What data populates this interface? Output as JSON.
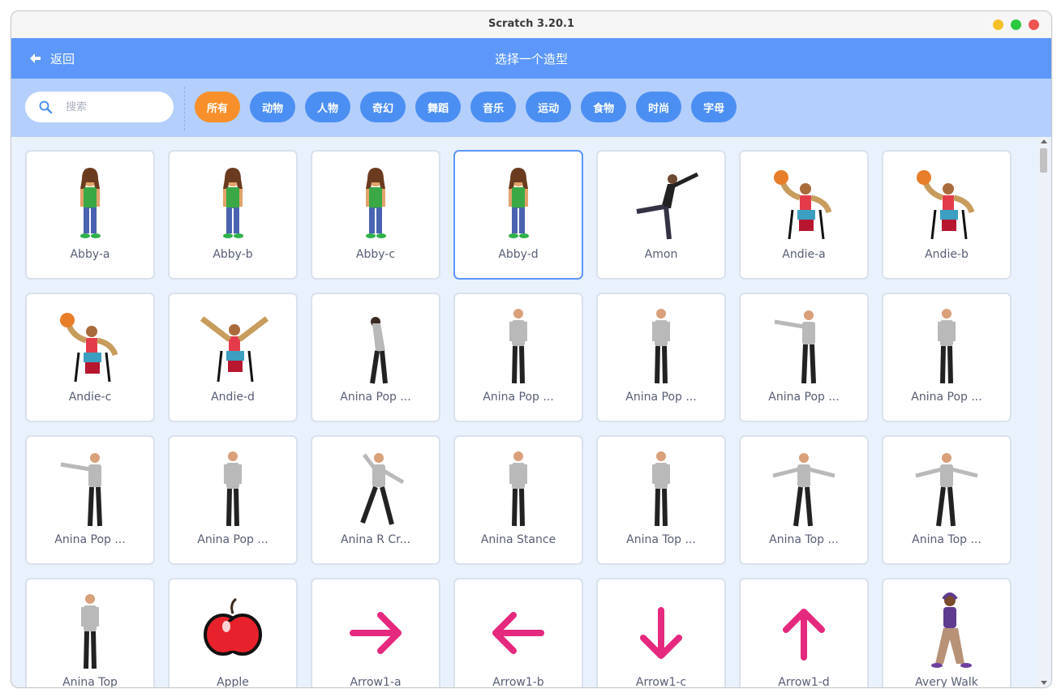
{
  "window": {
    "title": "Scratch 3.20.1"
  },
  "header": {
    "back_label": "返回",
    "title": "选择一个造型"
  },
  "search": {
    "placeholder": "搜索",
    "value": ""
  },
  "tags": [
    "所有",
    "动物",
    "人物",
    "奇幻",
    "舞蹈",
    "音乐",
    "运动",
    "食物",
    "时尚",
    "字母"
  ],
  "active_tag": "所有",
  "colors": {
    "header": "#5c97f9",
    "filter_bar": "#b4cffb",
    "tag": "#4c8ff2",
    "tag_active": "#f7902a",
    "arrow": "#e5297e"
  },
  "costumes": [
    {
      "name": "Abby-a",
      "icon": "girl-standing-icon"
    },
    {
      "name": "Abby-b",
      "icon": "girl-standing-icon"
    },
    {
      "name": "Abby-c",
      "icon": "girl-standing-icon"
    },
    {
      "name": "Abby-d",
      "icon": "girl-standing-icon",
      "selected": true
    },
    {
      "name": "Amon",
      "icon": "dancer-kick-icon"
    },
    {
      "name": "Andie-a",
      "icon": "wheelchair-basketball-icon"
    },
    {
      "name": "Andie-b",
      "icon": "wheelchair-basketball-icon"
    },
    {
      "name": "Andie-c",
      "icon": "wheelchair-basketball-icon"
    },
    {
      "name": "Andie-d",
      "icon": "wheelchair-arms-up-icon"
    },
    {
      "name": "Anina Pop ...",
      "icon": "dancer-bow-icon"
    },
    {
      "name": "Anina Pop ...",
      "icon": "dancer-standing-icon"
    },
    {
      "name": "Anina Pop ...",
      "icon": "dancer-standing-icon"
    },
    {
      "name": "Anina Pop ...",
      "icon": "dancer-point-icon"
    },
    {
      "name": "Anina Pop ...",
      "icon": "dancer-standing-icon"
    },
    {
      "name": "Anina Pop ...",
      "icon": "dancer-point-icon"
    },
    {
      "name": "Anina Pop ...",
      "icon": "dancer-standing-icon"
    },
    {
      "name": "Anina R Cr...",
      "icon": "dancer-lunge-icon"
    },
    {
      "name": "Anina Stance",
      "icon": "dancer-standing-icon"
    },
    {
      "name": "Anina Top ...",
      "icon": "dancer-standing-icon"
    },
    {
      "name": "Anina Top ...",
      "icon": "dancer-arms-out-icon"
    },
    {
      "name": "Anina Top ...",
      "icon": "dancer-arms-out-icon"
    },
    {
      "name": "Anina Top",
      "icon": "dancer-standing-icon"
    },
    {
      "name": "Apple",
      "icon": "apple-icon"
    },
    {
      "name": "Arrow1-a",
      "icon": "arrow-right-icon"
    },
    {
      "name": "Arrow1-b",
      "icon": "arrow-left-icon"
    },
    {
      "name": "Arrow1-c",
      "icon": "arrow-down-icon"
    },
    {
      "name": "Arrow1-d",
      "icon": "arrow-up-icon"
    },
    {
      "name": "Avery Walk",
      "icon": "girl-walking-icon"
    }
  ]
}
